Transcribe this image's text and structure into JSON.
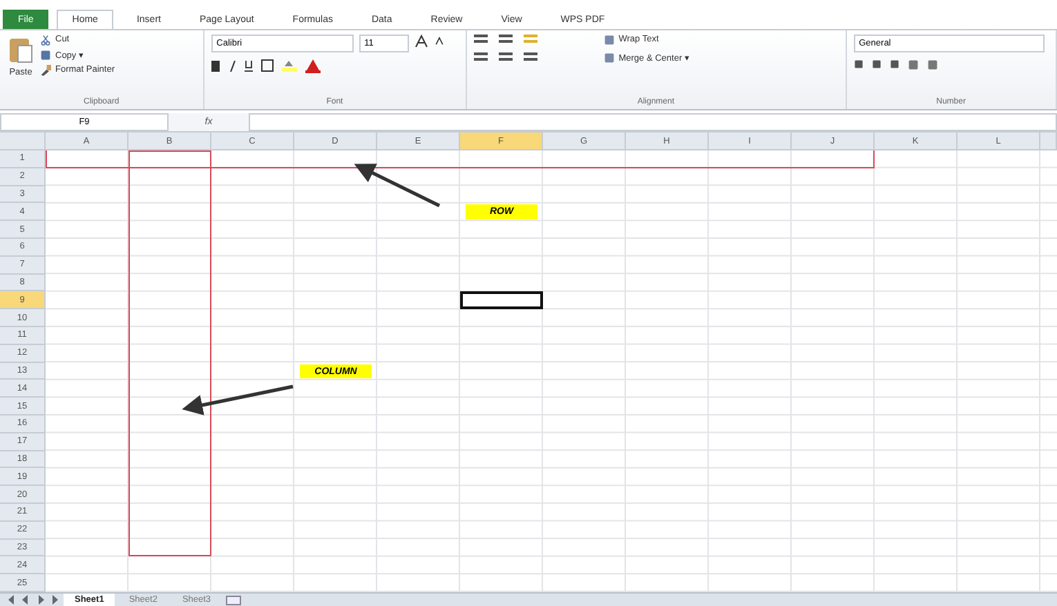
{
  "ribbon_tabs": [
    {
      "label": "File",
      "kind": "file",
      "selected": false
    },
    {
      "label": "Home",
      "kind": "tab",
      "selected": true
    },
    {
      "label": "Insert",
      "kind": "tab",
      "selected": false
    },
    {
      "label": "Page Layout",
      "kind": "tab",
      "selected": false
    },
    {
      "label": "Formulas",
      "kind": "tab",
      "selected": false
    },
    {
      "label": "Data",
      "kind": "tab",
      "selected": false
    },
    {
      "label": "Review",
      "kind": "tab",
      "selected": false
    },
    {
      "label": "View",
      "kind": "tab",
      "selected": false
    },
    {
      "label": "WPS PDF",
      "kind": "tab",
      "selected": false
    }
  ],
  "clipboard": {
    "paste": "Paste",
    "cut": "Cut",
    "copy": "Copy ▾",
    "format_painter": "Format Painter",
    "label": "Clipboard"
  },
  "font": {
    "name": "Calibri",
    "size": "11",
    "label": "Font"
  },
  "alignment": {
    "wrap": "Wrap Text",
    "merge": "Merge & Center ▾",
    "label": "Alignment"
  },
  "number": {
    "format": "General",
    "label": "Number"
  },
  "name_box": "F9",
  "formula_label": "fx",
  "columns": [
    {
      "label": "A",
      "selected": false
    },
    {
      "label": "B",
      "selected": false
    },
    {
      "label": "C",
      "selected": false
    },
    {
      "label": "D",
      "selected": false
    },
    {
      "label": "E",
      "selected": false
    },
    {
      "label": "F",
      "selected": true
    },
    {
      "label": "G",
      "selected": false
    },
    {
      "label": "H",
      "selected": false
    },
    {
      "label": "I",
      "selected": false
    },
    {
      "label": "J",
      "selected": false
    },
    {
      "label": "K",
      "selected": false
    },
    {
      "label": "L",
      "selected": false
    }
  ],
  "rows": [
    {
      "label": "1",
      "selected": false
    },
    {
      "label": "2",
      "selected": false
    },
    {
      "label": "3",
      "selected": false
    },
    {
      "label": "4",
      "selected": false
    },
    {
      "label": "5",
      "selected": false
    },
    {
      "label": "6",
      "selected": false
    },
    {
      "label": "7",
      "selected": false
    },
    {
      "label": "8",
      "selected": false
    },
    {
      "label": "9",
      "selected": true
    },
    {
      "label": "10",
      "selected": false
    },
    {
      "label": "11",
      "selected": false
    },
    {
      "label": "12",
      "selected": false
    },
    {
      "label": "13",
      "selected": false
    },
    {
      "label": "14",
      "selected": false
    },
    {
      "label": "15",
      "selected": false
    },
    {
      "label": "16",
      "selected": false
    },
    {
      "label": "17",
      "selected": false
    },
    {
      "label": "18",
      "selected": false
    },
    {
      "label": "19",
      "selected": false
    },
    {
      "label": "20",
      "selected": false
    },
    {
      "label": "21",
      "selected": false
    },
    {
      "label": "22",
      "selected": false
    },
    {
      "label": "23",
      "selected": false
    },
    {
      "label": "24",
      "selected": false
    },
    {
      "label": "25",
      "selected": false
    }
  ],
  "notes": [
    {
      "text": "ROW"
    },
    {
      "text": "COLUMN"
    }
  ],
  "sheet_tabs": [
    {
      "label": "Sheet1",
      "selected": true
    },
    {
      "label": "Sheet2",
      "selected": false
    },
    {
      "label": "Sheet3",
      "selected": false
    }
  ]
}
